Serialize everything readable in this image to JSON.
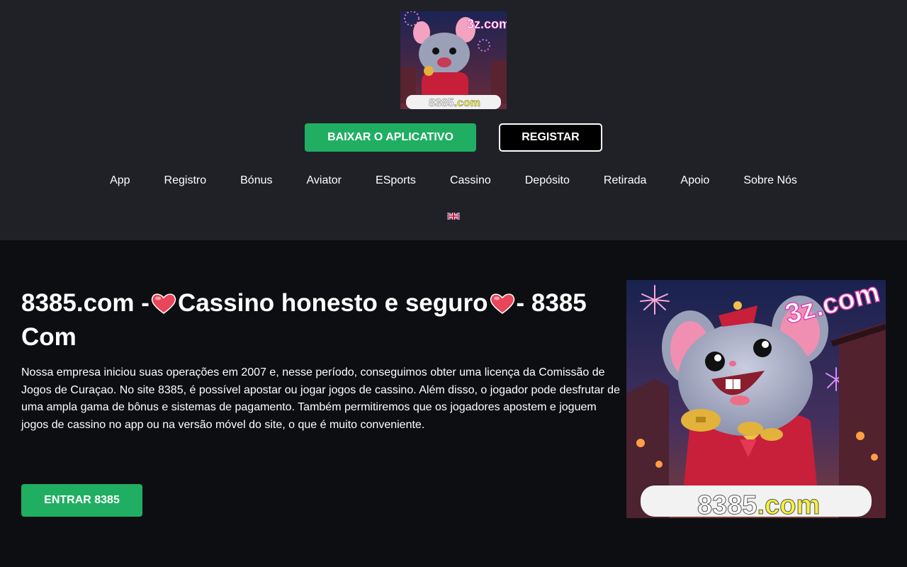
{
  "header": {
    "logo": {
      "icon": "mascot-logo-icon",
      "caption": "8385.com",
      "badge": "3z.com"
    },
    "download_label": "BAIXAR O APLICATIVO",
    "register_label": "REGISTAR",
    "nav": [
      "App",
      "Registro",
      "Bónus",
      "Aviator",
      "ESports",
      "Cassino",
      "Depósito",
      "Retirada",
      "Apoio",
      "Sobre Nós"
    ],
    "language_icon": "uk-flag-icon"
  },
  "main": {
    "title_part1": "8385.com -",
    "title_part2": "Cassino honesto e seguro",
    "title_part3": "- 8385 Com",
    "heart_icon": "heart-icon",
    "description": "Nossa empresa iniciou suas operações em 2007 e, nesse período, conseguimos obter uma licença da Comissão de Jogos de Curaçao. No site 8385, é possível apostar ou jogar jogos de cassino. Além disso, o jogador pode desfrutar de uma ampla gama de bônus e sistemas de pagamento. Também permitiremos que os jogadores apostem e joguem jogos de cassino no app ou na versão móvel do site, o que é muito conveniente.",
    "enter_label": "ENTRAR 8385",
    "hero": {
      "icon": "mascot-hero-icon",
      "caption_part1": "8385",
      "caption_part2": ".com",
      "badge": "3z.com"
    }
  },
  "colors": {
    "header_bg": "#1f2127",
    "page_bg": "#0d0e11",
    "accent_green": "#20ae63",
    "highlight_yellow": "#f4f23a"
  }
}
